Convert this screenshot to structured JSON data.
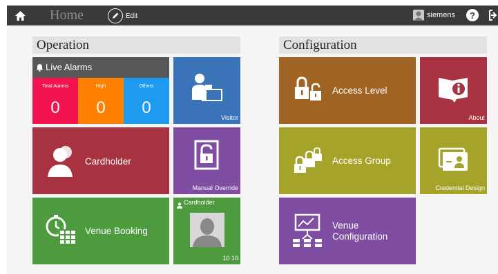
{
  "topbar": {
    "home_icon": "home-icon",
    "title": "Home",
    "edit_icon": "pencil-icon",
    "edit_label": "Edit",
    "user_icon": "user-avatar-icon",
    "user_name": "siemens",
    "help_label": "?",
    "exit_icon": "exit-icon"
  },
  "operation": {
    "header": "Operation",
    "live_alarms": {
      "title": "Live Alarms",
      "icon": "bell-icon",
      "cells": [
        {
          "label": "Total Alarms",
          "count": "0",
          "color": "#f2134f"
        },
        {
          "label": "High",
          "count": "0",
          "color": "#ff7f00"
        },
        {
          "label": "Others",
          "count": "0",
          "color": "#1e9bef"
        }
      ]
    },
    "visitor": {
      "label": "Visitor",
      "icon": "visitor-desk-icon",
      "color": "#3b73b9"
    },
    "cardholder": {
      "label": "Cardholder",
      "icon": "cardholder-person-icon",
      "color": "#a83240"
    },
    "manual_override": {
      "label": "Manual Override",
      "icon": "unlock-door-icon",
      "color": "#7f4ea3"
    },
    "venue_booking": {
      "label": "Venue Booking",
      "icon": "stopwatch-calendar-icon",
      "color": "#4e9a3f"
    },
    "cardholder_widget": {
      "title": "Cardholder",
      "icon": "person-small-icon",
      "photo_icon": "person-photo-icon",
      "counter": "10 10",
      "color": "#4e9a3f"
    }
  },
  "configuration": {
    "header": "Configuration",
    "access_level": {
      "label": "Access Level",
      "icon": "padlocks-icon",
      "color": "#a06524"
    },
    "about": {
      "label": "About",
      "icon": "info-book-icon",
      "color": "#a83240"
    },
    "access_group": {
      "label": "Access Group",
      "icon": "padlock-group-icon",
      "color": "#a6a32a"
    },
    "credential_design": {
      "label": "Credential Design",
      "icon": "id-card-icon",
      "color": "#a6a32a"
    },
    "venue_configuration": {
      "label_line1": "Venue",
      "label_line2": "Configuration",
      "icon": "presentation-board-icon",
      "color": "#7f4ea3"
    }
  }
}
